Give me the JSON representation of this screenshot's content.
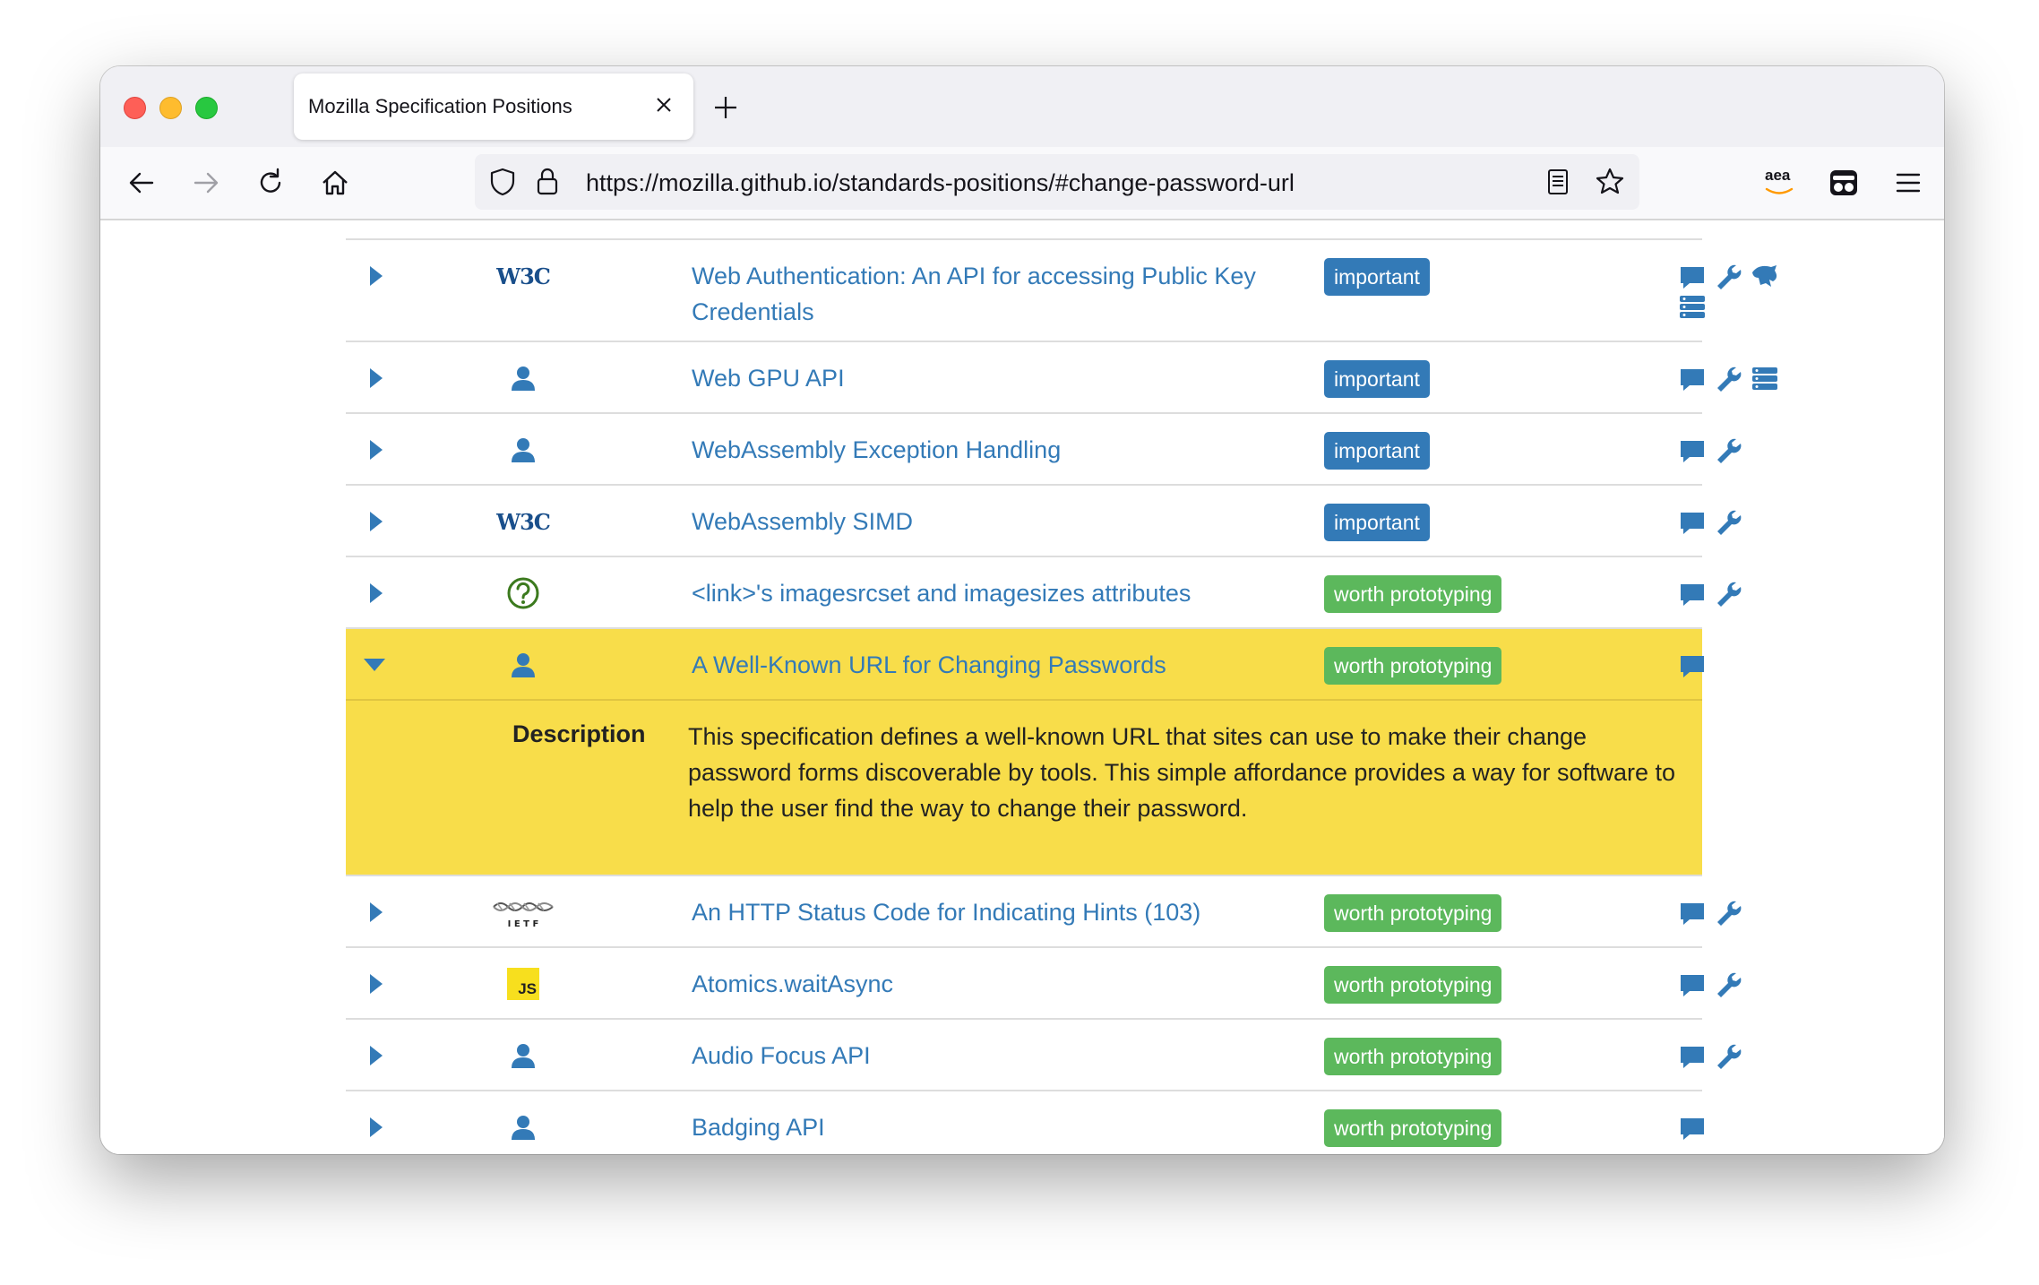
{
  "browser": {
    "tab_title": "Mozilla Specification Positions",
    "url": "https://mozilla.github.io/standards-positions/#change-password-url",
    "extension_label": "aea"
  },
  "colors": {
    "link": "#337ab7",
    "important": "#337ab7",
    "worth_prototyping": "#5cb85c",
    "highlight": "#f8dd4a"
  },
  "rows": [
    {
      "title": "Web Authentication: An API for accessing Public Key Credentials",
      "org": "w3c-logo",
      "position": "important",
      "expanded": false,
      "link_icons": [
        "comment-icon",
        "wrench-icon",
        "mozilla-dino-icon",
        "server-icon"
      ]
    },
    {
      "title": "Web GPU API",
      "org": "person-icon",
      "position": "important",
      "expanded": false,
      "link_icons": [
        "comment-icon",
        "wrench-icon",
        "server-icon"
      ]
    },
    {
      "title": "WebAssembly Exception Handling",
      "org": "person-icon",
      "position": "important",
      "expanded": false,
      "link_icons": [
        "comment-icon",
        "wrench-icon"
      ]
    },
    {
      "title": "WebAssembly SIMD",
      "org": "w3c-logo",
      "position": "important",
      "expanded": false,
      "link_icons": [
        "comment-icon",
        "wrench-icon"
      ]
    },
    {
      "title": "<link>'s imagesrcset and imagesizes attributes",
      "org": "question-icon",
      "position": "worth prototyping",
      "expanded": false,
      "link_icons": [
        "comment-icon",
        "wrench-icon"
      ]
    },
    {
      "title": "A Well-Known URL for Changing Passwords",
      "org": "person-icon",
      "position": "worth prototyping",
      "expanded": true,
      "link_icons": [
        "comment-icon"
      ]
    },
    {
      "title": "An HTTP Status Code for Indicating Hints (103)",
      "org": "ietf-logo",
      "position": "worth prototyping",
      "expanded": false,
      "link_icons": [
        "comment-icon",
        "wrench-icon"
      ]
    },
    {
      "title": "Atomics.waitAsync",
      "org": "js-logo",
      "position": "worth prototyping",
      "expanded": false,
      "link_icons": [
        "comment-icon",
        "wrench-icon"
      ]
    },
    {
      "title": "Audio Focus API",
      "org": "person-icon",
      "position": "worth prototyping",
      "expanded": false,
      "link_icons": [
        "comment-icon",
        "wrench-icon"
      ]
    },
    {
      "title": "Badging API",
      "org": "person-icon",
      "position": "worth prototyping",
      "expanded": false,
      "link_icons": [
        "comment-icon"
      ]
    }
  ],
  "expanded_detail": {
    "label": "Description",
    "text": "This specification defines a well-known URL that sites can use to make their change password forms discoverable by tools. This simple affordance provides a way for software to help the user find the way to change their password."
  },
  "org_logos": {
    "w3c": "W3C",
    "ietf": "I E T F",
    "js": "JS"
  }
}
